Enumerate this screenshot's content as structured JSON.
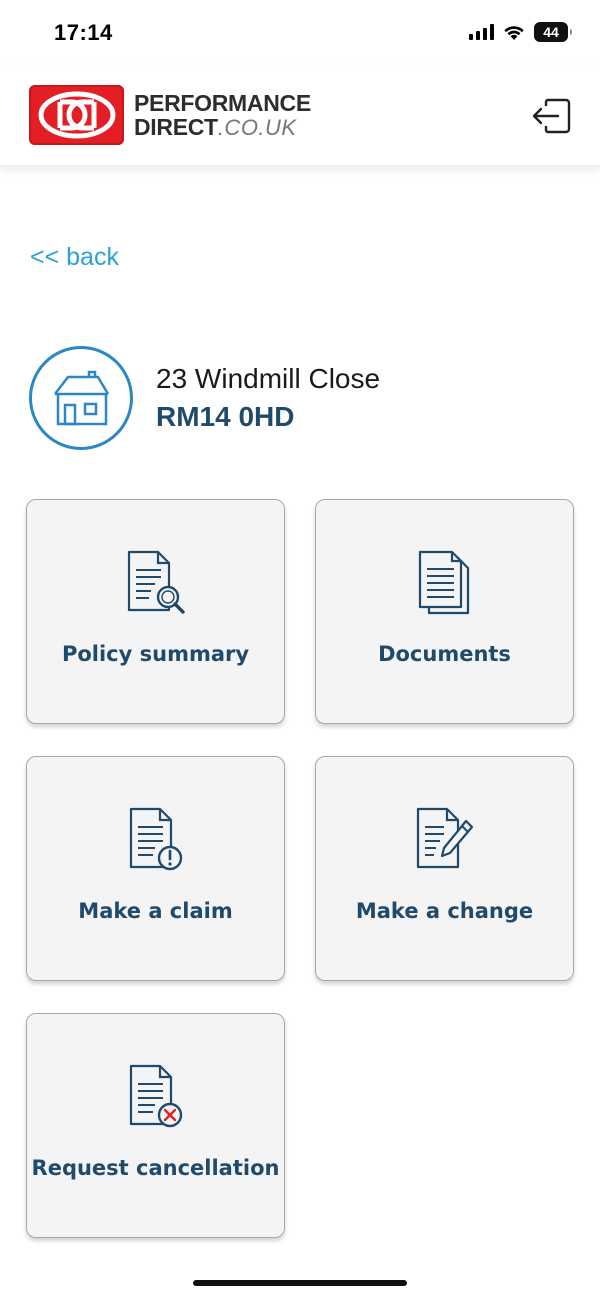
{
  "status_bar": {
    "time": "17:14",
    "battery": "44",
    "icons": [
      "signal-icon",
      "wifi-icon",
      "battery-icon"
    ]
  },
  "header": {
    "logo_line1": "PERFORMANCE",
    "logo_line2": "DIRECT",
    "logo_domain": ".CO.UK",
    "logout_icon": "logout-icon"
  },
  "nav": {
    "back_label": "<< back"
  },
  "property": {
    "address": "23 Windmill Close",
    "postcode": "RM14 0HD",
    "icon": "house-icon"
  },
  "tiles": [
    {
      "label": "Policy summary",
      "icon": "document-search-icon"
    },
    {
      "label": "Documents",
      "icon": "documents-icon"
    },
    {
      "label": "Make a claim",
      "icon": "document-alert-icon"
    },
    {
      "label": "Make a change",
      "icon": "document-edit-icon"
    },
    {
      "label": "Request cancellation",
      "icon": "document-cancel-icon"
    }
  ],
  "colors": {
    "brand_red": "#e31e24",
    "link_blue": "#2aa3d3",
    "navy_text": "#1f4a6b",
    "icon_stroke": "#1f4a6b",
    "house_circle": "#2b88c5",
    "cancel_red": "#e31e24"
  }
}
